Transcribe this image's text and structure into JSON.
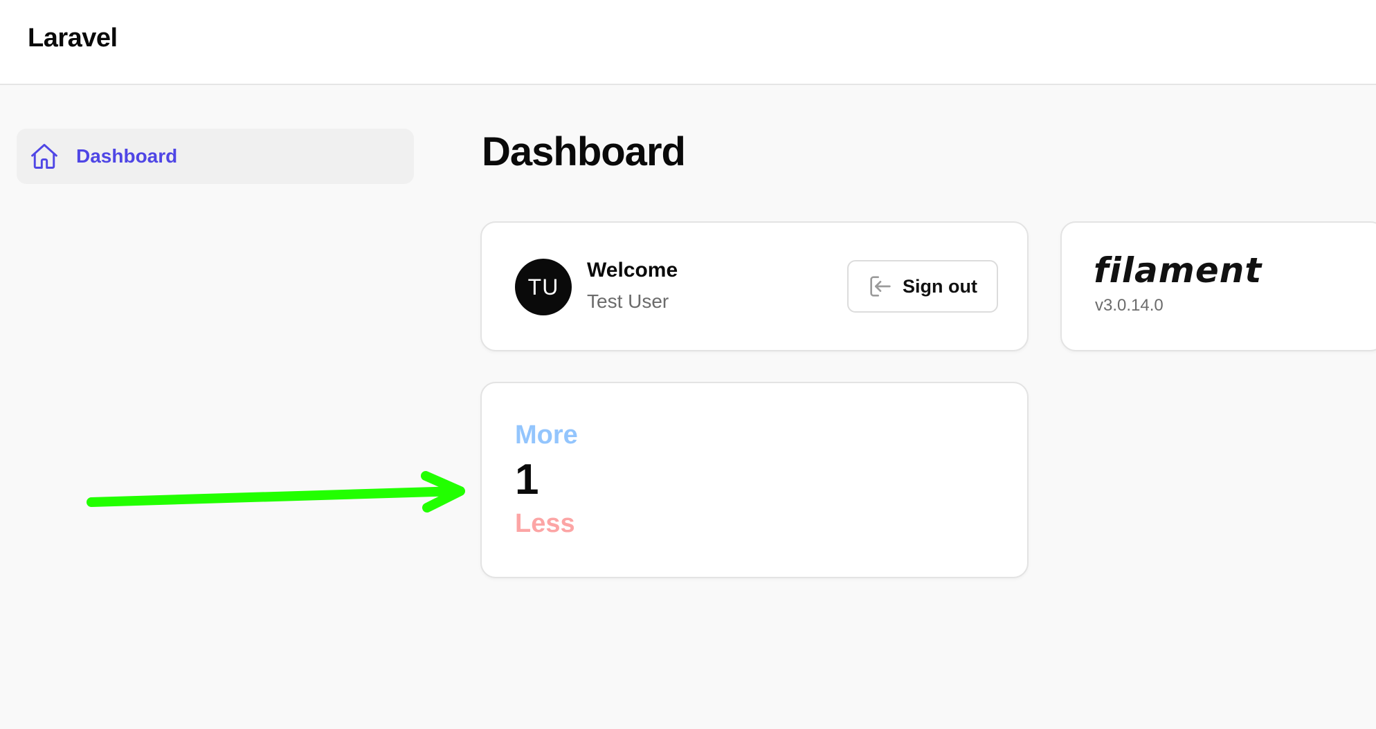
{
  "app": {
    "brand": "Laravel"
  },
  "sidebar": {
    "items": [
      {
        "label": "Dashboard",
        "icon": "home-icon",
        "active": true
      }
    ]
  },
  "page": {
    "title": "Dashboard"
  },
  "welcome_widget": {
    "avatar_initials": "TU",
    "title": "Welcome",
    "user_name": "Test User",
    "signout_label": "Sign out",
    "signout_icon": "sign-out-icon"
  },
  "filament_widget": {
    "logo_text": "filament",
    "version": "v3.0.14.0"
  },
  "stat_widget": {
    "more_label": "More",
    "value": "1",
    "less_label": "Less"
  },
  "colors": {
    "accent": "#4f46e5",
    "more": "#93c5fd",
    "less": "#fca5a5",
    "annotation_arrow": "#22ff00"
  }
}
